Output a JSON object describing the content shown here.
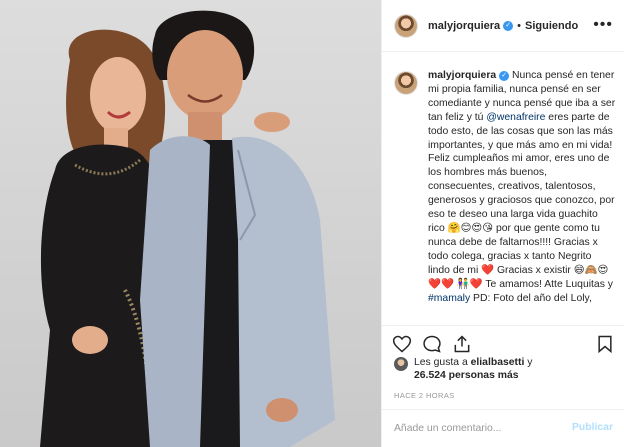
{
  "header": {
    "username": "malyjorquiera",
    "separator": "•",
    "follow_state": "Siguiendo",
    "more_label": "•••"
  },
  "caption": {
    "username": "malyjorquiera",
    "text_1": "Nunca pensé en tener mi propia familia, nunca pensé en ser comediante y nunca pensé que iba a ser tan feliz y tú",
    "mention": "@wenafreire",
    "text_2": "eres parte de todo esto, de las cosas que son las más importantes, y que más amo en mi vida! Feliz cumpleaños mi amor, eres uno de los hombres más buenos, consecuentes, creativos, talentosos, generosos y graciosos que conozco, por eso te deseo una larga vida guachito rico 🤗😊😍😘 por que gente como tu nunca debe de faltarnos!!!! Gracias x todo colega, gracias x tanto Negrito lindo de mi ❤️ Gracias x existir 😄🙈😍❤️❤️ 👫❤️ Te amamos! Atte Luquitas y",
    "mention_2": "#mamaly",
    "text_3": "PD: Foto del año del Loly,"
  },
  "likes": {
    "prefix": "Les gusta a",
    "liker": "elialbasetti",
    "middle": "y",
    "count": "26.524 personas más"
  },
  "timestamp": "HACE 2 HORAS",
  "comment_input": {
    "placeholder": "Añade un comentario..."
  },
  "publish_label": "Publicar",
  "icons": {
    "like": "heart-icon",
    "comment": "comment-icon",
    "share": "share-icon",
    "save": "bookmark-icon",
    "verified": "verified-badge-icon"
  },
  "colors": {
    "verified": "#3897f0",
    "publish_disabled": "#b2dffc",
    "mention": "#003569",
    "meta_text": "#999999"
  }
}
